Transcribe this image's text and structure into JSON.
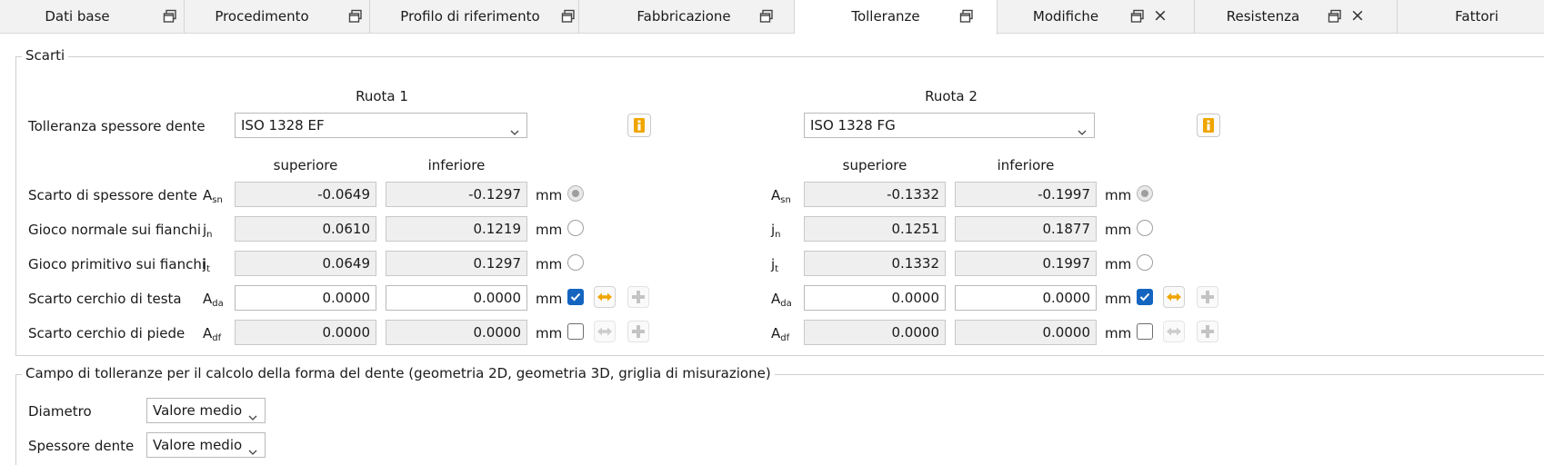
{
  "tabs": [
    {
      "label": "Dati base",
      "has_float": true,
      "has_close": false,
      "active": false
    },
    {
      "label": "Procedimento",
      "has_float": true,
      "has_close": false,
      "active": false
    },
    {
      "label": "Profilo di riferimento",
      "has_float": true,
      "has_close": false,
      "active": false
    },
    {
      "label": "Fabbricazione",
      "has_float": true,
      "has_close": false,
      "active": false
    },
    {
      "label": "Tolleranze",
      "has_float": true,
      "has_close": false,
      "active": true
    },
    {
      "label": "Modifiche",
      "has_float": true,
      "has_close": true,
      "active": false
    },
    {
      "label": "Resistenza",
      "has_float": true,
      "has_close": true,
      "active": false
    },
    {
      "label": "Fattori",
      "has_float": false,
      "has_close": false,
      "active": false
    }
  ],
  "scarti": {
    "title": "Scarti",
    "tolleranza_label": "Tolleranza spessore dente",
    "col_upper": "superiore",
    "col_lower": "inferiore",
    "unit": "mm",
    "rows": [
      {
        "label": "Scarto di spessore dente",
        "sym": "A",
        "sub": "sn"
      },
      {
        "label": "Gioco normale sui fianchi",
        "sym": "j",
        "sub": "n"
      },
      {
        "label": "Gioco primitivo sui fianchi",
        "sym": "j",
        "sub": "t"
      },
      {
        "label": "Scarto cerchio di testa",
        "sym": "A",
        "sub": "da"
      },
      {
        "label": "Scarto cerchio di piede",
        "sym": "A",
        "sub": "df"
      }
    ],
    "wheels": [
      {
        "title": "Ruota 1",
        "tolerance": "ISO 1328 EF",
        "values": [
          {
            "upper": "-0.0649",
            "lower": "-0.1297"
          },
          {
            "upper": "0.0610",
            "lower": "0.1219"
          },
          {
            "upper": "0.0649",
            "lower": "0.1297"
          },
          {
            "upper": "0.0000",
            "lower": "0.0000"
          },
          {
            "upper": "0.0000",
            "lower": "0.0000"
          }
        ],
        "radio_selected": 0,
        "check_testa": true,
        "check_piede": false
      },
      {
        "title": "Ruota 2",
        "tolerance": "ISO 1328 FG",
        "values": [
          {
            "upper": "-0.1332",
            "lower": "-0.1997"
          },
          {
            "upper": "0.1251",
            "lower": "0.1877"
          },
          {
            "upper": "0.1332",
            "lower": "0.1997"
          },
          {
            "upper": "0.0000",
            "lower": "0.0000"
          },
          {
            "upper": "0.0000",
            "lower": "0.0000"
          }
        ],
        "radio_selected": 0,
        "check_testa": true,
        "check_piede": false
      }
    ]
  },
  "campo": {
    "title": "Campo di tolleranze per il calcolo della forma del dente (geometria 2D, geometria 3D, griglia di misurazione)",
    "diametro_label": "Diametro",
    "diametro_value": "Valore medio",
    "spessore_label": "Spessore dente",
    "spessore_value": "Valore medio"
  },
  "colors": {
    "accent_blue": "#1565c0",
    "icon_orange": "#f0a500",
    "field_readonly": "#efefef"
  }
}
